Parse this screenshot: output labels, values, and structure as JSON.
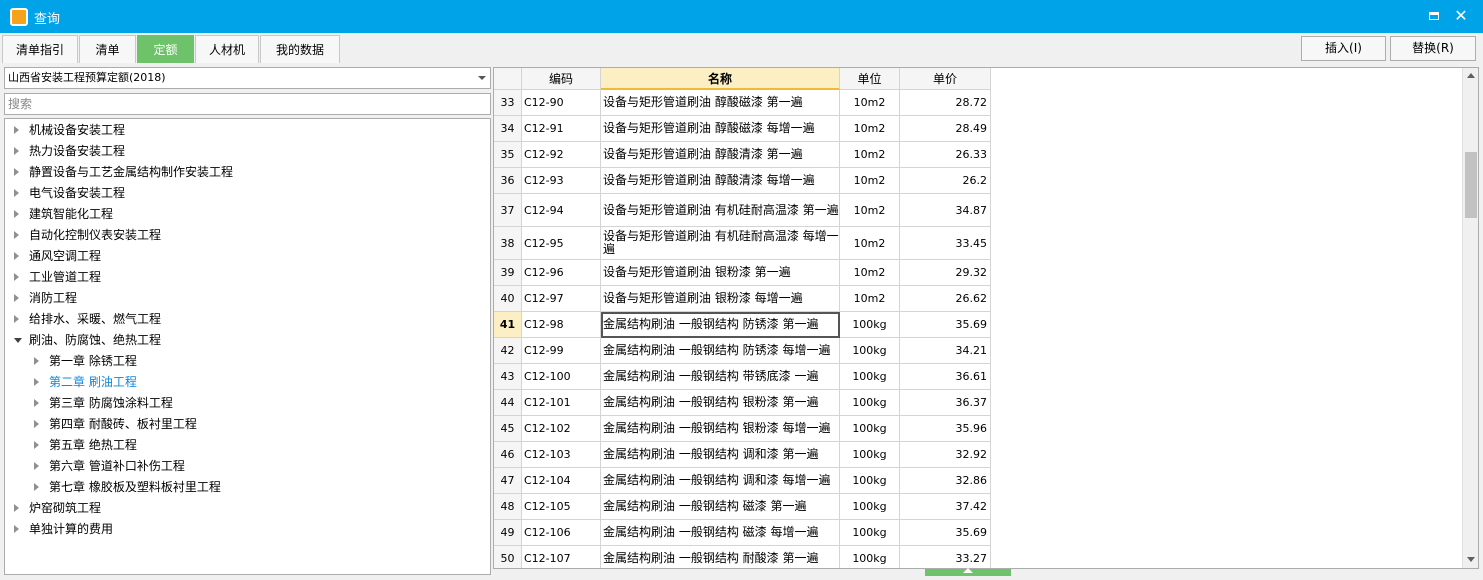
{
  "window": {
    "title": "查询",
    "maximize_label": "",
    "close_label": "✕"
  },
  "tabs": [
    {
      "label": "清单指引",
      "active": false
    },
    {
      "label": "清单",
      "active": false
    },
    {
      "label": "定额",
      "active": true
    },
    {
      "label": "人材机",
      "active": false
    },
    {
      "label": "我的数据",
      "active": false
    }
  ],
  "actions": {
    "insert_label": "插入(I)",
    "replace_label": "替换(R)"
  },
  "left": {
    "library_selected": "山西省安装工程预算定额(2018)",
    "search_placeholder": "搜索",
    "search_value": "",
    "tree": [
      {
        "label": "机械设备安装工程",
        "level": 0,
        "expanded": false
      },
      {
        "label": "热力设备安装工程",
        "level": 0,
        "expanded": false
      },
      {
        "label": "静置设备与工艺金属结构制作安装工程",
        "level": 0,
        "expanded": false
      },
      {
        "label": "电气设备安装工程",
        "level": 0,
        "expanded": false
      },
      {
        "label": "建筑智能化工程",
        "level": 0,
        "expanded": false
      },
      {
        "label": "自动化控制仪表安装工程",
        "level": 0,
        "expanded": false
      },
      {
        "label": "通风空调工程",
        "level": 0,
        "expanded": false
      },
      {
        "label": "工业管道工程",
        "level": 0,
        "expanded": false
      },
      {
        "label": "消防工程",
        "level": 0,
        "expanded": false
      },
      {
        "label": "给排水、采暖、燃气工程",
        "level": 0,
        "expanded": false
      },
      {
        "label": "刷油、防腐蚀、绝热工程",
        "level": 0,
        "expanded": true
      },
      {
        "label": "第一章  除锈工程",
        "level": 1,
        "expanded": false
      },
      {
        "label": "第二章  刷油工程",
        "level": 1,
        "expanded": false,
        "selected": true
      },
      {
        "label": "第三章  防腐蚀涂料工程",
        "level": 1,
        "expanded": false
      },
      {
        "label": "第四章  耐酸砖、板衬里工程",
        "level": 1,
        "expanded": false
      },
      {
        "label": "第五章  绝热工程",
        "level": 1,
        "expanded": false
      },
      {
        "label": "第六章  管道补口补伤工程",
        "level": 1,
        "expanded": false
      },
      {
        "label": "第七章  橡胶板及塑料板衬里工程",
        "level": 1,
        "expanded": false
      },
      {
        "label": "炉窑砌筑工程",
        "level": 0,
        "expanded": false
      },
      {
        "label": "单独计算的费用",
        "level": 0,
        "expanded": false
      }
    ]
  },
  "grid": {
    "columns": {
      "no": "",
      "code": "编码",
      "name": "名称",
      "unit": "单位",
      "price": "单价"
    },
    "rows": [
      {
        "no": "33",
        "code": "C12-90",
        "name": "设备与矩形管道刷油 醇酸磁漆 第一遍",
        "unit": "10m2",
        "price": "28.72"
      },
      {
        "no": "34",
        "code": "C12-91",
        "name": "设备与矩形管道刷油 醇酸磁漆 每增一遍",
        "unit": "10m2",
        "price": "28.49"
      },
      {
        "no": "35",
        "code": "C12-92",
        "name": "设备与矩形管道刷油 醇酸清漆 第一遍",
        "unit": "10m2",
        "price": "26.33"
      },
      {
        "no": "36",
        "code": "C12-93",
        "name": "设备与矩形管道刷油 醇酸清漆 每增一遍",
        "unit": "10m2",
        "price": "26.2"
      },
      {
        "no": "37",
        "code": "C12-94",
        "name": "设备与矩形管道刷油 有机硅耐高温漆 第一遍",
        "unit": "10m2",
        "price": "34.87"
      },
      {
        "no": "38",
        "code": "C12-95",
        "name": "设备与矩形管道刷油 有机硅耐高温漆 每增一遍",
        "unit": "10m2",
        "price": "33.45"
      },
      {
        "no": "39",
        "code": "C12-96",
        "name": "设备与矩形管道刷油 银粉漆 第一遍",
        "unit": "10m2",
        "price": "29.32"
      },
      {
        "no": "40",
        "code": "C12-97",
        "name": "设备与矩形管道刷油 银粉漆 每增一遍",
        "unit": "10m2",
        "price": "26.62"
      },
      {
        "no": "41",
        "code": "C12-98",
        "name": "金属结构刷油 一般钢结构 防锈漆 第一遍",
        "unit": "100kg",
        "price": "35.69"
      },
      {
        "no": "42",
        "code": "C12-99",
        "name": "金属结构刷油 一般钢结构 防锈漆 每增一遍",
        "unit": "100kg",
        "price": "34.21"
      },
      {
        "no": "43",
        "code": "C12-100",
        "name": "金属结构刷油 一般钢结构 带锈底漆 一遍",
        "unit": "100kg",
        "price": "36.61"
      },
      {
        "no": "44",
        "code": "C12-101",
        "name": "金属结构刷油 一般钢结构 银粉漆 第一遍",
        "unit": "100kg",
        "price": "36.37"
      },
      {
        "no": "45",
        "code": "C12-102",
        "name": "金属结构刷油 一般钢结构 银粉漆 每增一遍",
        "unit": "100kg",
        "price": "35.96"
      },
      {
        "no": "46",
        "code": "C12-103",
        "name": "金属结构刷油 一般钢结构 调和漆 第一遍",
        "unit": "100kg",
        "price": "32.92"
      },
      {
        "no": "47",
        "code": "C12-104",
        "name": "金属结构刷油 一般钢结构 调和漆 每增一遍",
        "unit": "100kg",
        "price": "32.86"
      },
      {
        "no": "48",
        "code": "C12-105",
        "name": "金属结构刷油 一般钢结构 磁漆 第一遍",
        "unit": "100kg",
        "price": "37.42"
      },
      {
        "no": "49",
        "code": "C12-106",
        "name": "金属结构刷油 一般钢结构 磁漆 每增一遍",
        "unit": "100kg",
        "price": "35.69"
      },
      {
        "no": "50",
        "code": "C12-107",
        "name": "金属结构刷油 一般钢结构 耐酸漆 第一遍",
        "unit": "100kg",
        "price": "33.27"
      }
    ],
    "active_row": "41"
  },
  "colors": {
    "titlebar": "#00a2e8",
    "active_tab": "#6ec26a",
    "selected_text": "#1188d8",
    "header_highlight": "#fdefc4"
  },
  "icons": {
    "app": "app-icon",
    "maximize": "maximize-icon",
    "close": "close-icon",
    "collapsed": "triangle-right-icon",
    "expanded": "triangle-down-icon",
    "dropdown": "chevron-down-icon"
  }
}
